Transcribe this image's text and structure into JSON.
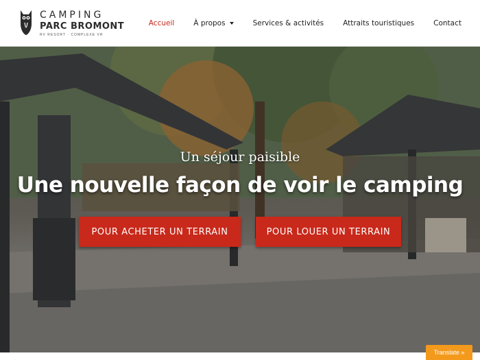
{
  "brand": {
    "line1": "CAMPING",
    "line2": "PARC BROMONT",
    "line3": "RV RESORT · COMPLEXE VR"
  },
  "nav": {
    "items": [
      {
        "label": "Accueil",
        "active": true
      },
      {
        "label": "À propos",
        "dropdown": true
      },
      {
        "label": "Services & activités"
      },
      {
        "label": "Attraits touristiques"
      },
      {
        "label": "Contact"
      }
    ]
  },
  "hero": {
    "subtitle": "Un séjour paisible",
    "headline": "Une nouvelle façon de voir le camping",
    "buy_button": "POUR ACHETER UN TERRAIN",
    "rent_button": "POUR LOUER UN TERRAIN"
  },
  "translate": {
    "label": "Translate »"
  },
  "colors": {
    "accent": "#c8291b",
    "translate": "#f39a1d"
  }
}
